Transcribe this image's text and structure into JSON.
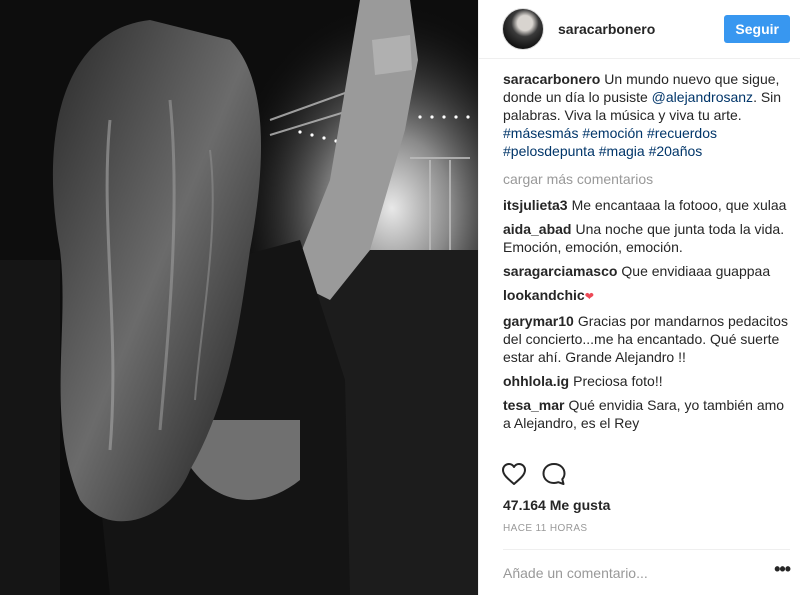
{
  "post": {
    "username": "saracarbonero",
    "follow_label": "Seguir",
    "caption": {
      "user": "saracarbonero",
      "text_before_mention": "Un mundo nuevo que sigue, donde un día lo pusiste ",
      "mention": "@alejandrosanz",
      "text_after_mention": ". Sin palabras. Viva la música y viva tu arte.",
      "hashtags": [
        "#másesmás",
        "#emoción",
        "#recuerdos",
        "#pelosdepunta",
        "#magia",
        "#20años"
      ]
    },
    "load_more_label": "cargar más comentarios",
    "comments": [
      {
        "user": "itsjulieta3",
        "text": "Me encantaaa la fotooo, que xulaa"
      },
      {
        "user": "aida_abad",
        "text": "Una noche que junta toda la vida. Emoción, emoción, emoción."
      },
      {
        "user": "saragarciamasco",
        "text": "Que envidiaaa guappaa"
      },
      {
        "user": "lookandchic",
        "text": "❤"
      },
      {
        "user": "garymar10",
        "text": "Gracias por mandarnos pedacitos del concierto...me ha encantado. Qué suerte estar ahí. Grande Alejandro !!"
      },
      {
        "user": "ohhlola.ig",
        "text": "Preciosa foto!!"
      },
      {
        "user": "tesa_mar",
        "text": "Qué envidia Sara, yo también amo a Alejandro, es el Rey"
      }
    ],
    "likes_label": "47.164 Me gusta",
    "timestamp": "HACE 11 HORAS",
    "add_comment_placeholder": "Añade un comentario...",
    "more_options": "•••",
    "icons": {
      "like": "heart-outline-icon",
      "comment": "speech-bubble-icon",
      "options": "more-dots-icon"
    },
    "colors": {
      "accent": "#3897f0",
      "link": "#003569",
      "muted": "#999999",
      "text": "#262626"
    }
  }
}
